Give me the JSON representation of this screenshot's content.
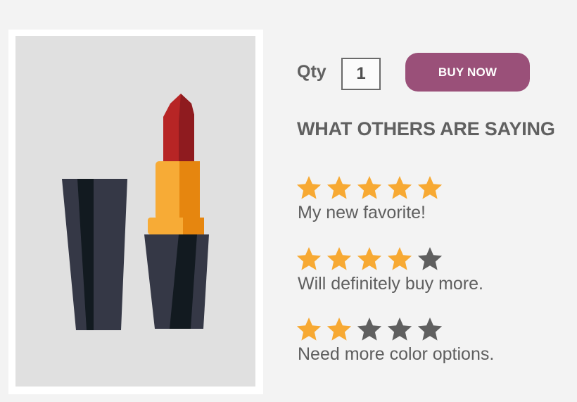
{
  "product": {
    "image_alt": "lipstick",
    "colors": {
      "background": "#e0e0e0",
      "frame": "#ffffff",
      "case_dark": "#353846",
      "case_shadow": "#121a20",
      "tube_gold": "#f7ab36",
      "tube_gold_dark": "#e6860f",
      "lipstick_red": "#b72525",
      "lipstick_red_dark": "#8f1b1f"
    }
  },
  "purchase": {
    "qty_label": "Qty",
    "qty_value": "1",
    "buy_label": "BUY NOW",
    "buy_color": "#9a5079"
  },
  "reviews_section": {
    "heading": "WHAT OTHERS ARE SAYING",
    "star_filled_color": "#f7a933",
    "star_empty_color": "#5f5f5f",
    "max_stars": 5,
    "reviews": [
      {
        "rating": 5,
        "text": "My new favorite!"
      },
      {
        "rating": 4,
        "text": "Will definitely buy more."
      },
      {
        "rating": 2,
        "text": "Need more color options."
      }
    ]
  }
}
